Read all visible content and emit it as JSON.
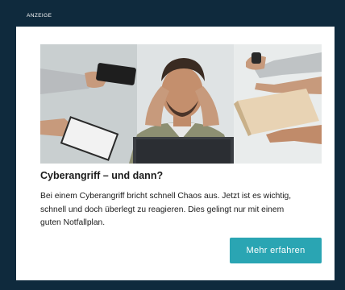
{
  "ad": {
    "label": "ANZEIGE",
    "image_description_icon": "stressed-person-photo",
    "headline": "Cyberangriff – und dann?",
    "body_lines": [
      "Bei einem Cyberangriff bricht schnell Chaos aus. Jetzt ist es wichtig,",
      "schnell und doch überlegt zu reagieren. Dies gelingt nur mit einem",
      "guten Notfallplan."
    ],
    "cta_label": "Mehr erfahren"
  },
  "colors": {
    "frame": "#0f2a3d",
    "card": "#ffffff",
    "cta": "#2aa5b3",
    "text": "#1b1b1b"
  }
}
